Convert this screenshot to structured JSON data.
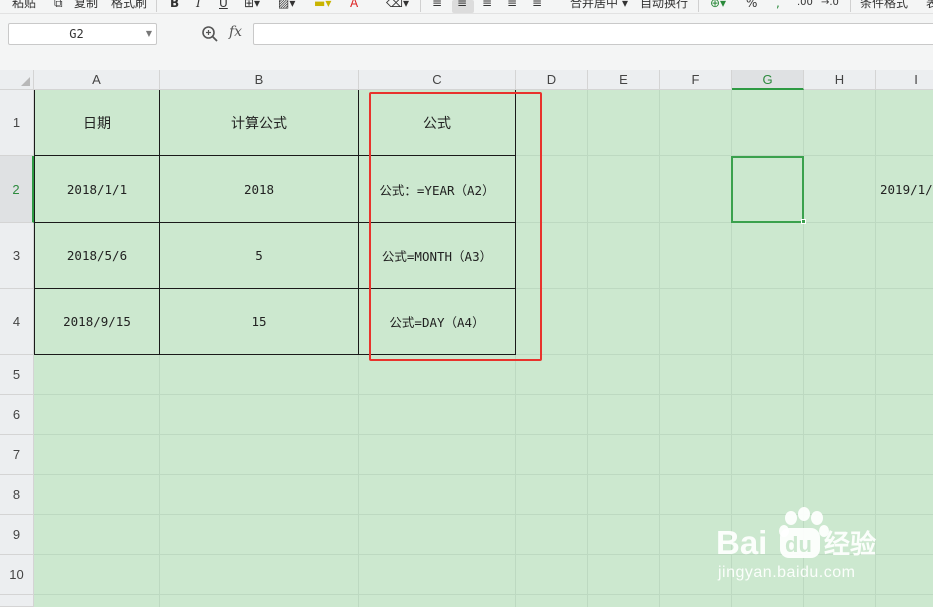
{
  "ribbon": {
    "paste_label": "粘贴",
    "copy_label": "复制",
    "format_painter_label": "格式刷",
    "bold_label": "B",
    "italic_label": "I",
    "underline_label": "U",
    "font_color_label": "A",
    "merge_center_label": "合并居中",
    "wrap_text_label": "自动换行",
    "percent_label": "%",
    "comma_label": ",",
    "increase_decimal_label": ".00",
    "decrease_decimal_label": "→.0",
    "conditional_format_label": "条件格式",
    "more_label": "表"
  },
  "formula_bar": {
    "name_box_value": "G2",
    "fx_label": "fx",
    "formula_value": ""
  },
  "columns": [
    "A",
    "B",
    "C",
    "D",
    "E",
    "F",
    "G",
    "H",
    "I"
  ],
  "rows": [
    "1",
    "2",
    "3",
    "4",
    "5",
    "6",
    "7",
    "8",
    "9",
    "10"
  ],
  "selected_cell": "G2",
  "table": {
    "header": {
      "a": "日期",
      "b": "计算公式",
      "c": "公式"
    },
    "rows": [
      {
        "a": "2018/1/1",
        "b": "2018",
        "c": "公式：=YEAR（A2）"
      },
      {
        "a": "2018/5/6",
        "b": "5",
        "c": "公式=MONTH（A3）"
      },
      {
        "a": "2018/9/15",
        "b": "15",
        "c": "公式=DAY（A4）"
      }
    ]
  },
  "cell_i2": "2019/1/",
  "watermark": {
    "brand_text": "Bai",
    "brand_du": "du",
    "brand_cn": "经验",
    "url": "jingyan.baidu.com"
  },
  "colors": {
    "grid_background": "#cce8cf",
    "selection": "#3aa14d",
    "highlight_box": "#e8322c"
  }
}
